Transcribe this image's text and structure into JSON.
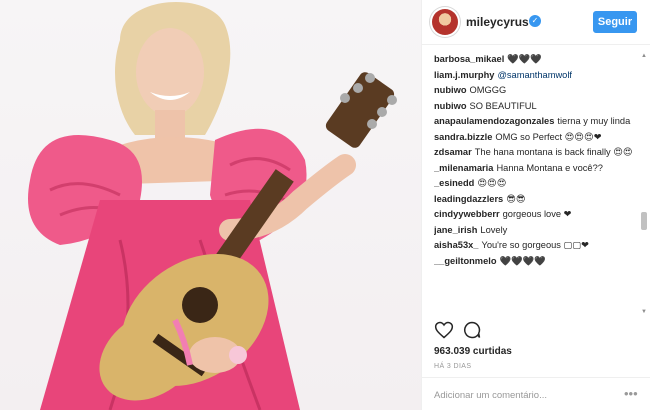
{
  "header": {
    "username": "mileycyrus",
    "follow_label": "Seguir"
  },
  "comments": [
    {
      "user": "barbosa_mikael",
      "text": "🖤🖤🖤"
    },
    {
      "user": "liam.j.murphy",
      "mention": "@samanthamwolf",
      "text": ""
    },
    {
      "user": "nubiwo",
      "text": "OMGGG"
    },
    {
      "user": "nubiwo",
      "text": "SO BEAUTIFUL"
    },
    {
      "user": "anapaulamendozagonzales",
      "text": "tierna y muy linda"
    },
    {
      "user": "sandra.bizzle",
      "text": "OMG so Perfect 😍😍😍❤"
    },
    {
      "user": "zdsamar",
      "text": "The hana montana is back finally 😍😍"
    },
    {
      "user": "_milenamaria",
      "text": "Hanna Montana e você??"
    },
    {
      "user": "_esinedd",
      "text": "😍😍😍"
    },
    {
      "user": "leadingdazzlers",
      "text": "😎😎"
    },
    {
      "user": "cindyywebberr",
      "text": "gorgeous love ❤"
    },
    {
      "user": "jane_irish",
      "text": "Lovely"
    },
    {
      "user": "aisha53x_",
      "text": "You're so gorgeous ▢▢❤"
    },
    {
      "user": "__geiltonmelo",
      "text": "🖤🖤🖤🖤"
    }
  ],
  "likes": "963.039 curtidas",
  "date": "HÁ 3 DIAS",
  "comment_placeholder": "Adicionar um comentário...",
  "icons": [
    "heart-icon",
    "comment-icon",
    "more-options-icon",
    "verified-badge-icon"
  ],
  "colors": {
    "accent": "#3897f0",
    "dress": "#e8457a",
    "guitar": "#d9b46a"
  }
}
